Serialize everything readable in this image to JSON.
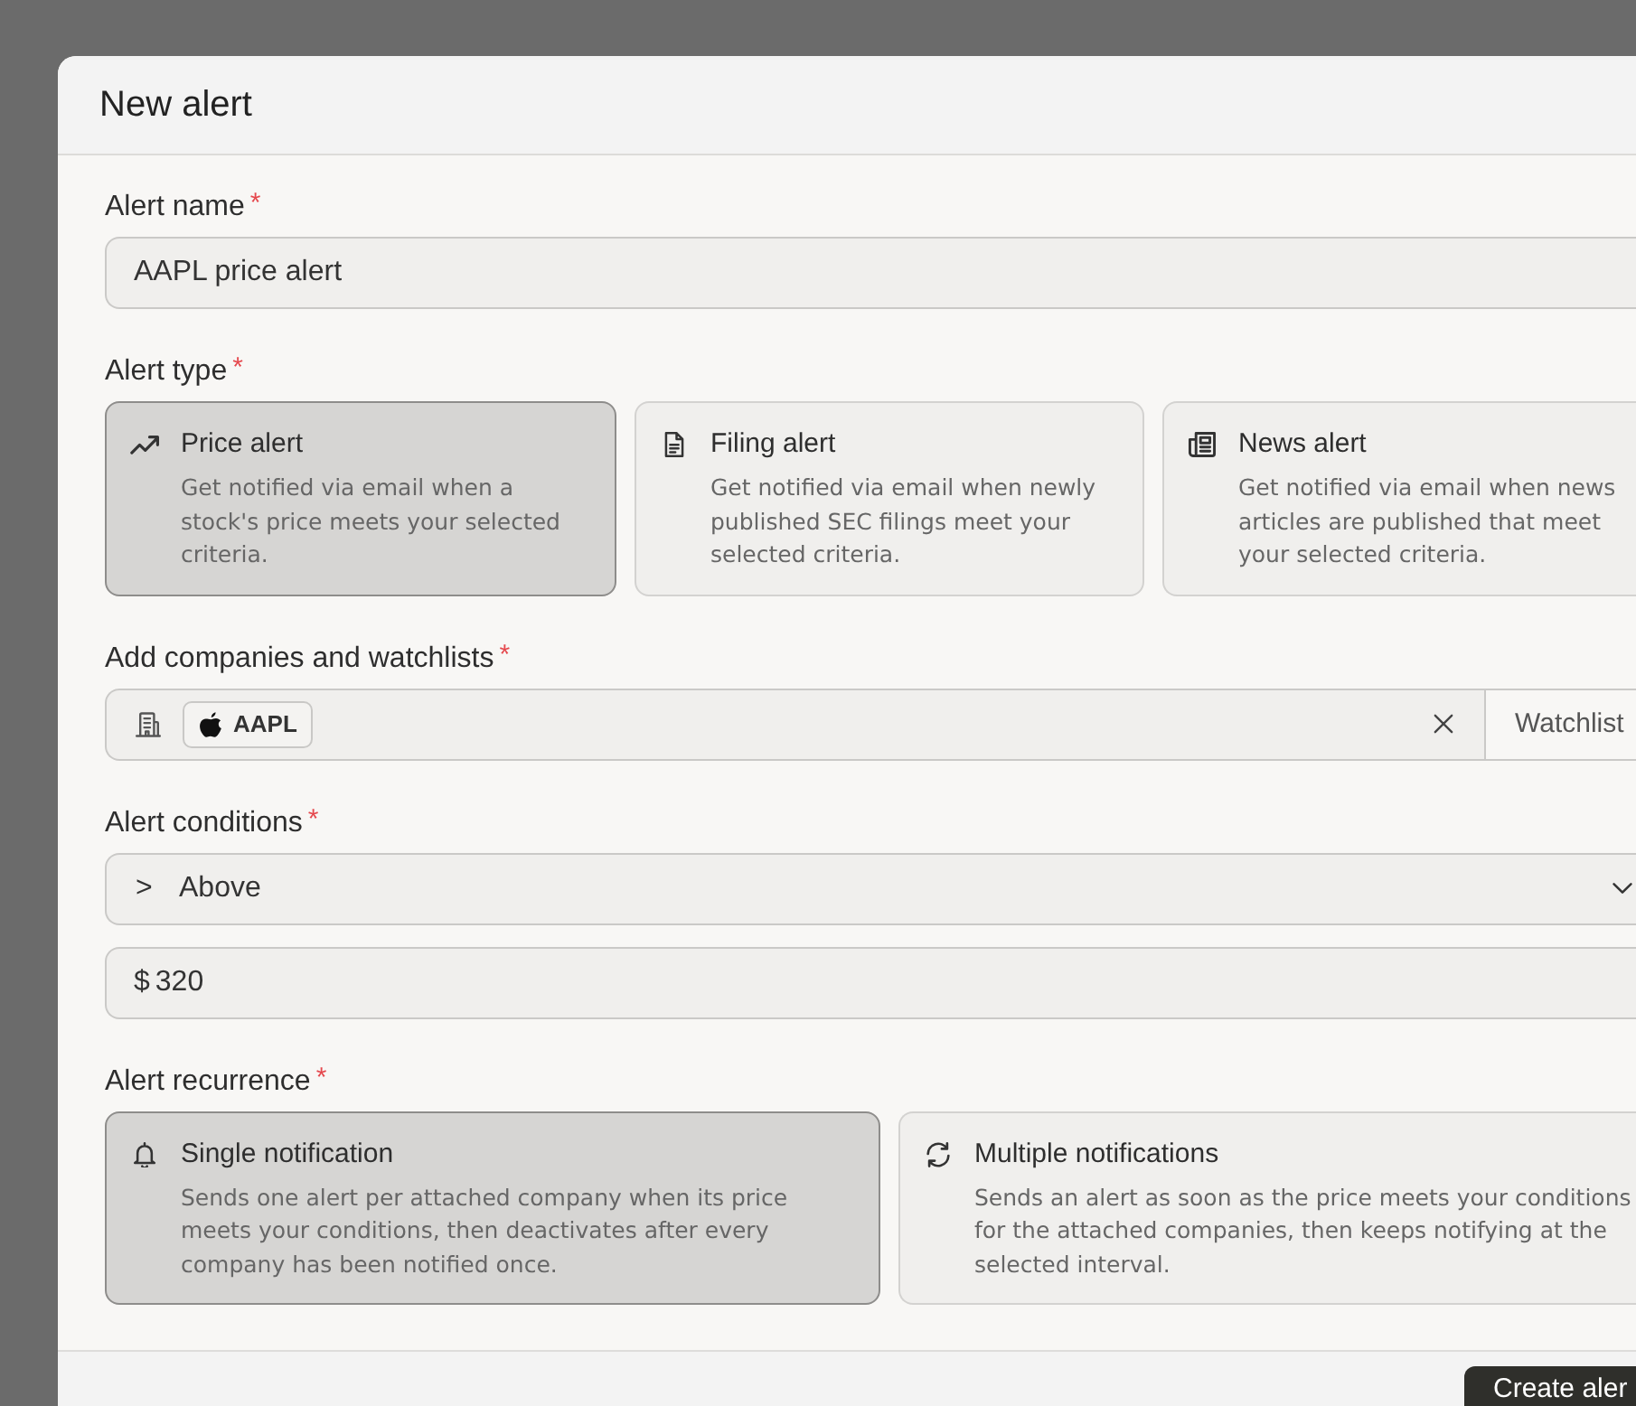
{
  "title": "New alert",
  "alert_name": {
    "label": "Alert name",
    "required_mark": "*",
    "value": "AAPL price alert"
  },
  "alert_type": {
    "label": "Alert type",
    "required_mark": "*",
    "options": [
      {
        "kind": "price",
        "title": "Price alert",
        "description": "Get notified via email when a stock's price meets your selected criteria.",
        "selected": true
      },
      {
        "kind": "filing",
        "title": "Filing alert",
        "description": "Get notified via email when newly published SEC filings meet your selected criteria.",
        "selected": false
      },
      {
        "kind": "news",
        "title": "News alert",
        "description": "Get notified via email when news articles are published that meet your selected criteria.",
        "selected": false
      }
    ]
  },
  "companies": {
    "label": "Add companies and watchlists",
    "required_mark": "*",
    "chips": [
      {
        "label": "AAPL"
      }
    ],
    "watchlists_button": "Watchlist"
  },
  "conditions": {
    "label": "Alert conditions",
    "required_mark": "*",
    "operator_symbol": ">",
    "operator": "Above",
    "currency": "$",
    "value": "320"
  },
  "recurrence": {
    "label": "Alert recurrence",
    "required_mark": "*",
    "options": [
      {
        "kind": "single",
        "title": "Single notification",
        "description": "Sends one alert per attached company when its price meets your conditions, then deactivates after every company has been notified once.",
        "selected": true
      },
      {
        "kind": "multiple",
        "title": "Multiple notifications",
        "description": "Sends an alert as soon as the price meets your conditions for the attached companies, then keeps notifying at the selected interval.",
        "selected": false
      }
    ]
  },
  "footer": {
    "primary_button": "Create aler"
  }
}
